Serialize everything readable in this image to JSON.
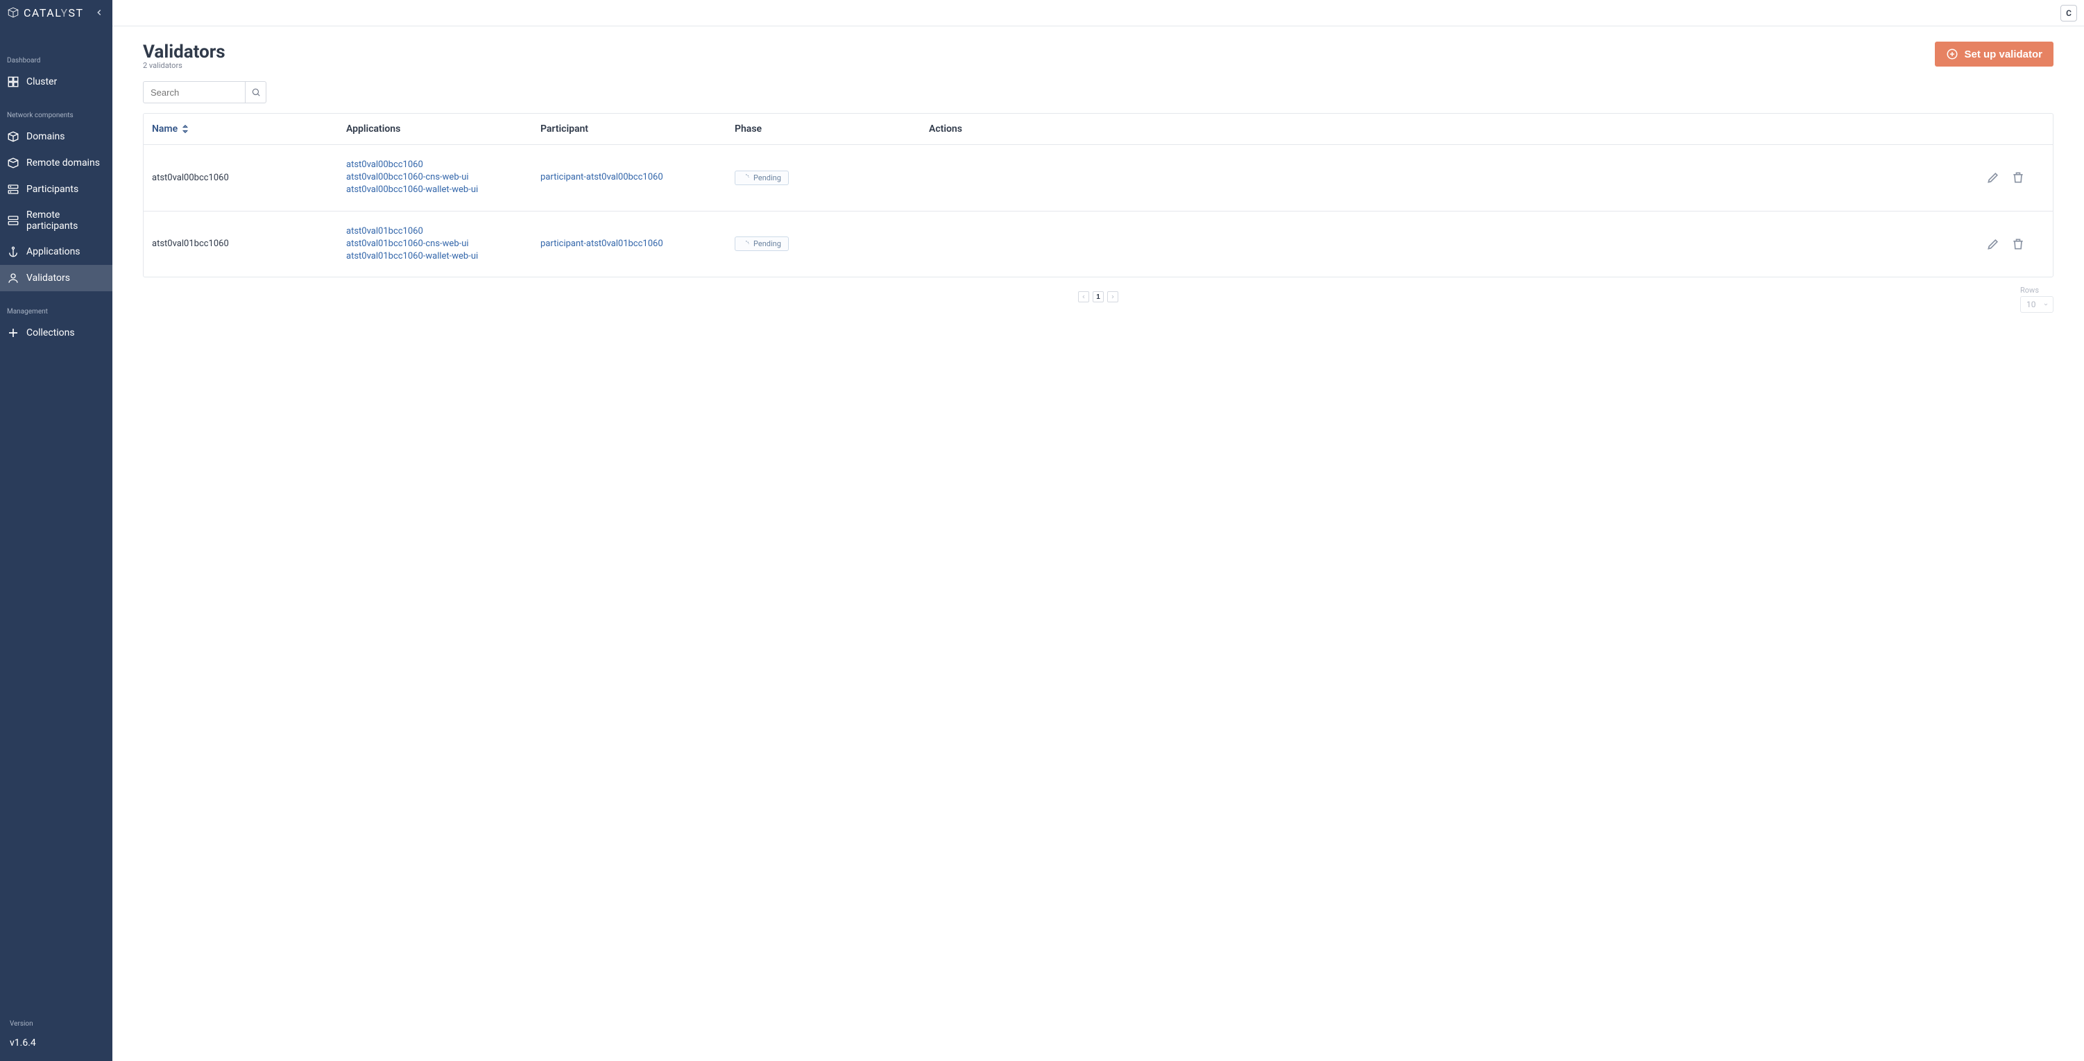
{
  "brand": {
    "text_a": "CATAL",
    "text_b": "Y",
    "text_c": "ST"
  },
  "user_initial": "C",
  "sidebar": {
    "dashboard_label": "Dashboard",
    "network_label": "Network components",
    "management_label": "Management",
    "version_label": "Version",
    "version": "v1.6.4",
    "items": {
      "cluster": "Cluster",
      "domains": "Domains",
      "remote_domains": "Remote domains",
      "participants": "Participants",
      "remote_participants": "Remote participants",
      "applications": "Applications",
      "validators": "Validators",
      "collections": "Collections"
    }
  },
  "page": {
    "title": "Validators",
    "subtitle": "2 validators",
    "primary_action": "Set up validator",
    "search_placeholder": "Search"
  },
  "table": {
    "columns": {
      "name": "Name",
      "applications": "Applications",
      "participant": "Participant",
      "phase": "Phase",
      "actions": "Actions"
    },
    "pending_label": "Pending",
    "rows": [
      {
        "name": "atst0val00bcc1060",
        "apps": [
          "atst0val00bcc1060",
          "atst0val00bcc1060-cns-web-ui",
          "atst0val00bcc1060-wallet-web-ui"
        ],
        "participant": "participant-atst0val00bcc1060",
        "phase": "Pending"
      },
      {
        "name": "atst0val01bcc1060",
        "apps": [
          "atst0val01bcc1060",
          "atst0val01bcc1060-cns-web-ui",
          "atst0val01bcc1060-wallet-web-ui"
        ],
        "participant": "participant-atst0val01bcc1060",
        "phase": "Pending"
      }
    ]
  },
  "pagination": {
    "current": "1",
    "rows_label": "Rows",
    "rows_value": "10"
  }
}
